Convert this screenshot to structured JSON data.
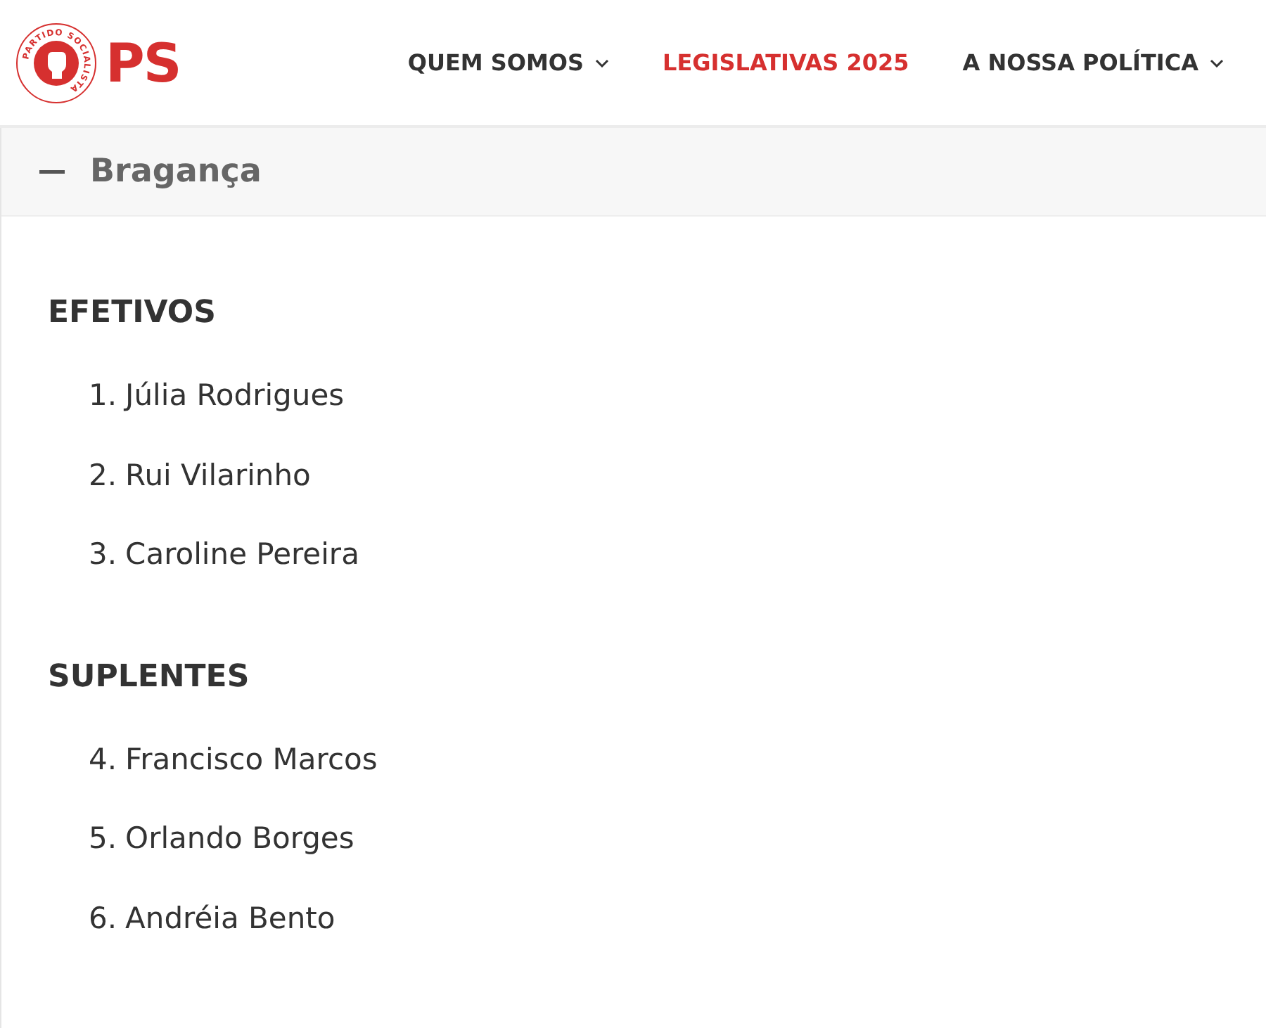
{
  "logo": {
    "ring_text": "PARTIDO SOCIALISTA",
    "wordmark": "PS"
  },
  "nav": [
    {
      "label": "QUEM SOMOS",
      "selected": false,
      "has_dropdown": true
    },
    {
      "label": "LEGISLATIVAS 2025",
      "selected": true,
      "has_dropdown": false
    },
    {
      "label": "A NOSSA POLÍTICA",
      "selected": false,
      "has_dropdown": true
    }
  ],
  "accordion": {
    "title": "Bragança",
    "expanded": true,
    "sections": [
      {
        "heading": "EFETIVOS",
        "items": [
          {
            "number": "1.",
            "name": "Júlia Rodrigues"
          },
          {
            "number": "2.",
            "name": "Rui Vilarinho"
          },
          {
            "number": "3.",
            "name": "Caroline Pereira"
          }
        ]
      },
      {
        "heading": "SUPLENTES",
        "items": [
          {
            "number": "4.",
            "name": "Francisco Marcos"
          },
          {
            "number": "5.",
            "name": "Orlando Borges"
          },
          {
            "number": "6.",
            "name": "Andréia Bento"
          }
        ]
      }
    ]
  }
}
